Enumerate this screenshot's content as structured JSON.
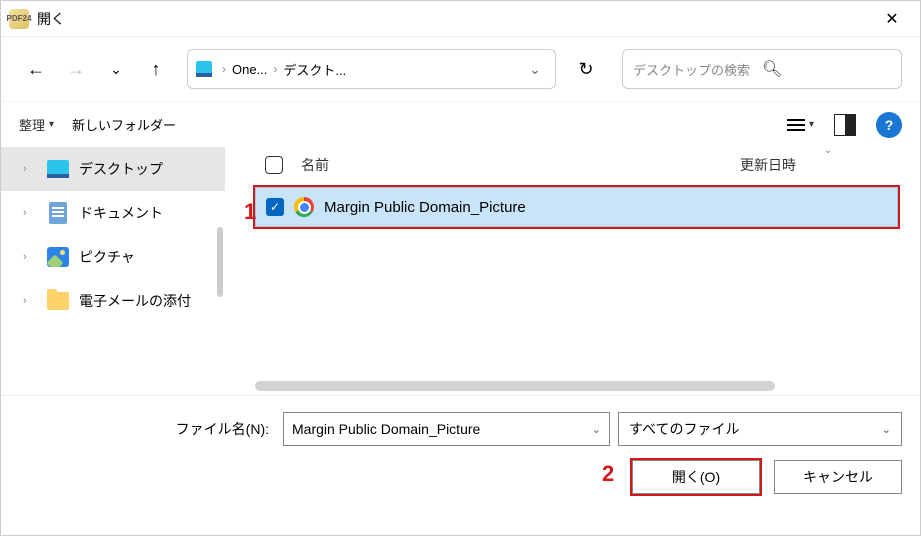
{
  "title": "開く",
  "app_icon_label": "PDF24",
  "breadcrumb": {
    "item1": "One...",
    "item2": "デスクト..."
  },
  "search": {
    "placeholder": "デスクトップの検索"
  },
  "toolbar": {
    "organize": "整理",
    "new_folder": "新しいフォルダー",
    "help": "?"
  },
  "nav": {
    "items": [
      {
        "label": "デスクトップ"
      },
      {
        "label": "ドキュメント"
      },
      {
        "label": "ピクチャ"
      },
      {
        "label": "電子メールの添付"
      }
    ]
  },
  "columns": {
    "name": "名前",
    "date": "更新日時"
  },
  "files": [
    {
      "name": "Margin Public Domain_Picture"
    }
  ],
  "filename_label": "ファイル名(N):",
  "filename_value": "Margin Public Domain_Picture",
  "filter_value": "すべてのファイル",
  "buttons": {
    "open": "開く(O)",
    "cancel": "キャンセル"
  },
  "annotations": {
    "one": "1",
    "two": "2"
  }
}
